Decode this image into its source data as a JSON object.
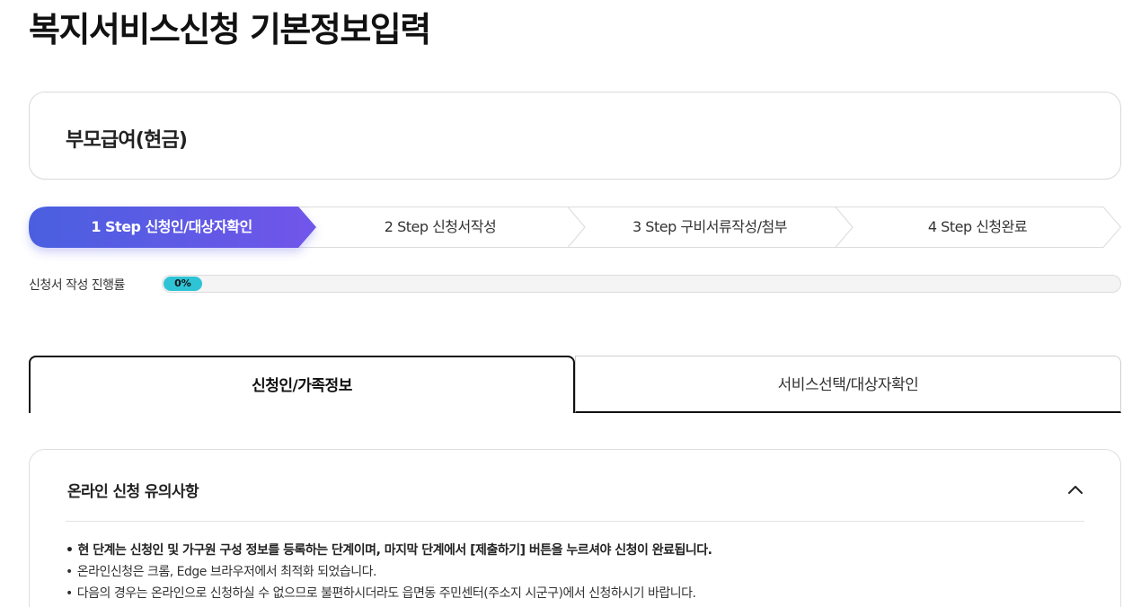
{
  "page": {
    "title": "복지서비스신청 기본정보입력"
  },
  "service": {
    "name": "부모급여(현금)"
  },
  "steps": [
    {
      "label": "1 Step 신청인/대상자확인",
      "active": true
    },
    {
      "label": "2 Step 신청서작성",
      "active": false
    },
    {
      "label": "3 Step 구비서류작성/첨부",
      "active": false
    },
    {
      "label": "4 Step 신청완료",
      "active": false
    }
  ],
  "progress": {
    "label": "신청서 작성 진행률",
    "value_text": "0%",
    "value": 0
  },
  "tabs": [
    {
      "label": "신청인/가족정보",
      "active": true
    },
    {
      "label": "서비스선택/대상자확인",
      "active": false
    }
  ],
  "notice": {
    "title": "온라인 신청 유의사항",
    "expanded": true,
    "items": [
      "현 단계는 신청인 및 가구원 구성 정보를 등록하는 단계이며, 마지막 단계에서 [제출하기] 버튼을 누르셔야 신청이 완료됩니다.",
      "온라인신청은 크롬, Edge 브라우저에서 최적화 되었습니다.",
      "다음의 경우는 온라인으로 신청하실 수 없으므로 불편하시더라도 읍면동 주민센터(주소지 시군구)에서 신청하시기 바랍니다."
    ]
  },
  "colors": {
    "step_active_start": "#4a5fe0",
    "step_active_end": "#7156ea",
    "progress_fill": "#2ec4d6",
    "tab_border": "#111111"
  },
  "icons": {
    "collapse": "chevron-up-icon"
  }
}
